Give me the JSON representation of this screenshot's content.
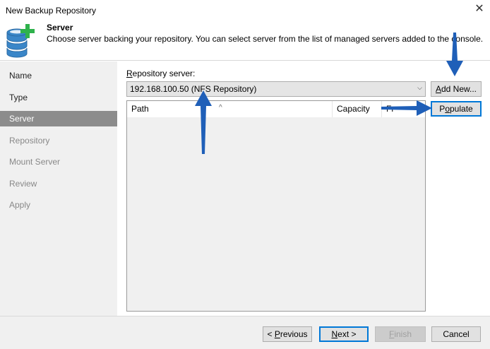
{
  "window": {
    "title": "New Backup Repository",
    "close_glyph": "✕"
  },
  "header": {
    "title": "Server",
    "description": "Choose server backing your repository. You can select server from the list of managed servers added to the console."
  },
  "sidebar": {
    "steps": [
      {
        "label": "Name",
        "state": "done"
      },
      {
        "label": "Type",
        "state": "done"
      },
      {
        "label": "Server",
        "state": "active"
      },
      {
        "label": "Repository",
        "state": "pending"
      },
      {
        "label": "Mount Server",
        "state": "pending"
      },
      {
        "label": "Review",
        "state": "pending"
      },
      {
        "label": "Apply",
        "state": "pending"
      }
    ]
  },
  "server": {
    "label_prefix": "R",
    "label_rest": "epository server:",
    "selected": "192.168.100.50 (NFS Repository)",
    "add_new_label_u": "A",
    "add_new_label_rest": "dd New...",
    "populate_label_pre": "P",
    "populate_label_u": "o",
    "populate_label_rest": "pulate"
  },
  "table": {
    "columns": [
      "Path",
      "Capacity",
      "Fr"
    ],
    "rows": []
  },
  "footer": {
    "previous_label_pre": "< ",
    "previous_label_u": "P",
    "previous_label_rest": "revious",
    "next_label_u": "N",
    "next_label_rest": "ext >",
    "finish_label_u": "F",
    "finish_label_rest": "inish",
    "cancel_label": "Cancel"
  },
  "colors": {
    "accent": "#0078d7",
    "annotation_arrow": "#1f5fb8",
    "logo_green": "#2fb24c",
    "logo_blue": "#3a86c8"
  },
  "icons": [
    "database-add-icon",
    "close-icon",
    "dropdown-chevron-icon",
    "sort-up-icon"
  ]
}
